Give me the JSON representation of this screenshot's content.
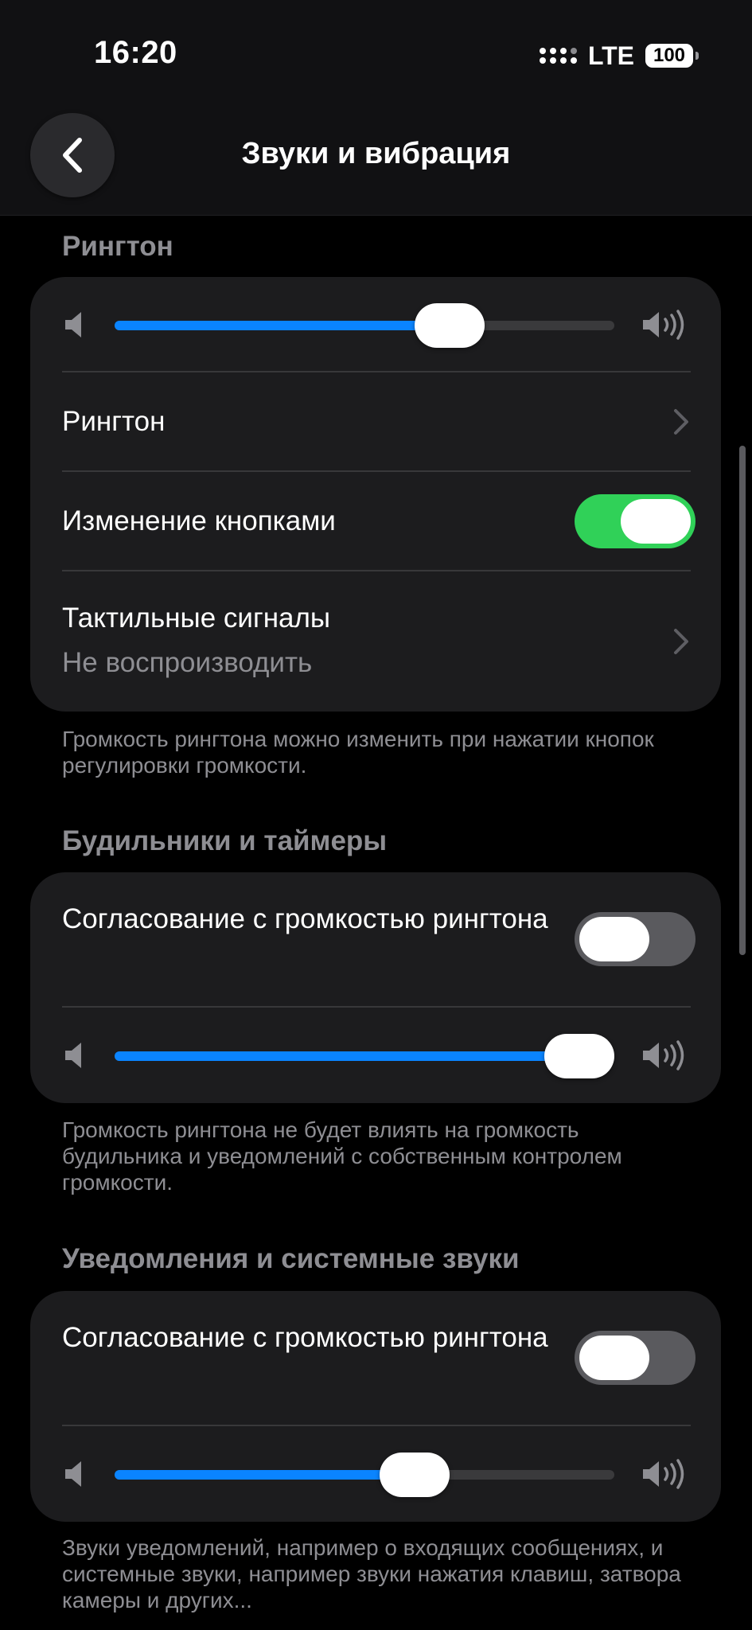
{
  "status_bar": {
    "time": "16:20",
    "network": "LTE",
    "battery": "100"
  },
  "nav": {
    "title": "Звуки и вибрация"
  },
  "ringtone": {
    "header": "Рингтон",
    "volume": 0.67,
    "ringtone_label": "Рингтон",
    "buttons_label": "Изменение кнопками",
    "buttons_on": true,
    "haptics_label": "Тактильные сигналы",
    "haptics_value": "Не воспроизводить",
    "footer": "Громкость рингтона можно изменить при нажатии кнопок регулировки громкости."
  },
  "alarms": {
    "header": "Будильники и таймеры",
    "match_label": "Согласование с громкостью рингтона",
    "match_on": false,
    "volume": 0.94,
    "footer": "Громкость рингтона не будет влиять на громкость будильника и уведомлений с собственным контролем громкости."
  },
  "notifications": {
    "header": "Уведомления и системные звуки",
    "match_label": "Согласование с громкостью рингтона",
    "match_on": false,
    "volume": 0.6,
    "footer": "Звуки уведомлений, например о входящих сообщениях, и системные звуки, например звуки нажатия клавиш, затвора камеры и других..."
  },
  "colors": {
    "accent": "#0a84ff",
    "toggle_on": "#30d158",
    "background": "#000000",
    "card": "#1c1c1e"
  }
}
